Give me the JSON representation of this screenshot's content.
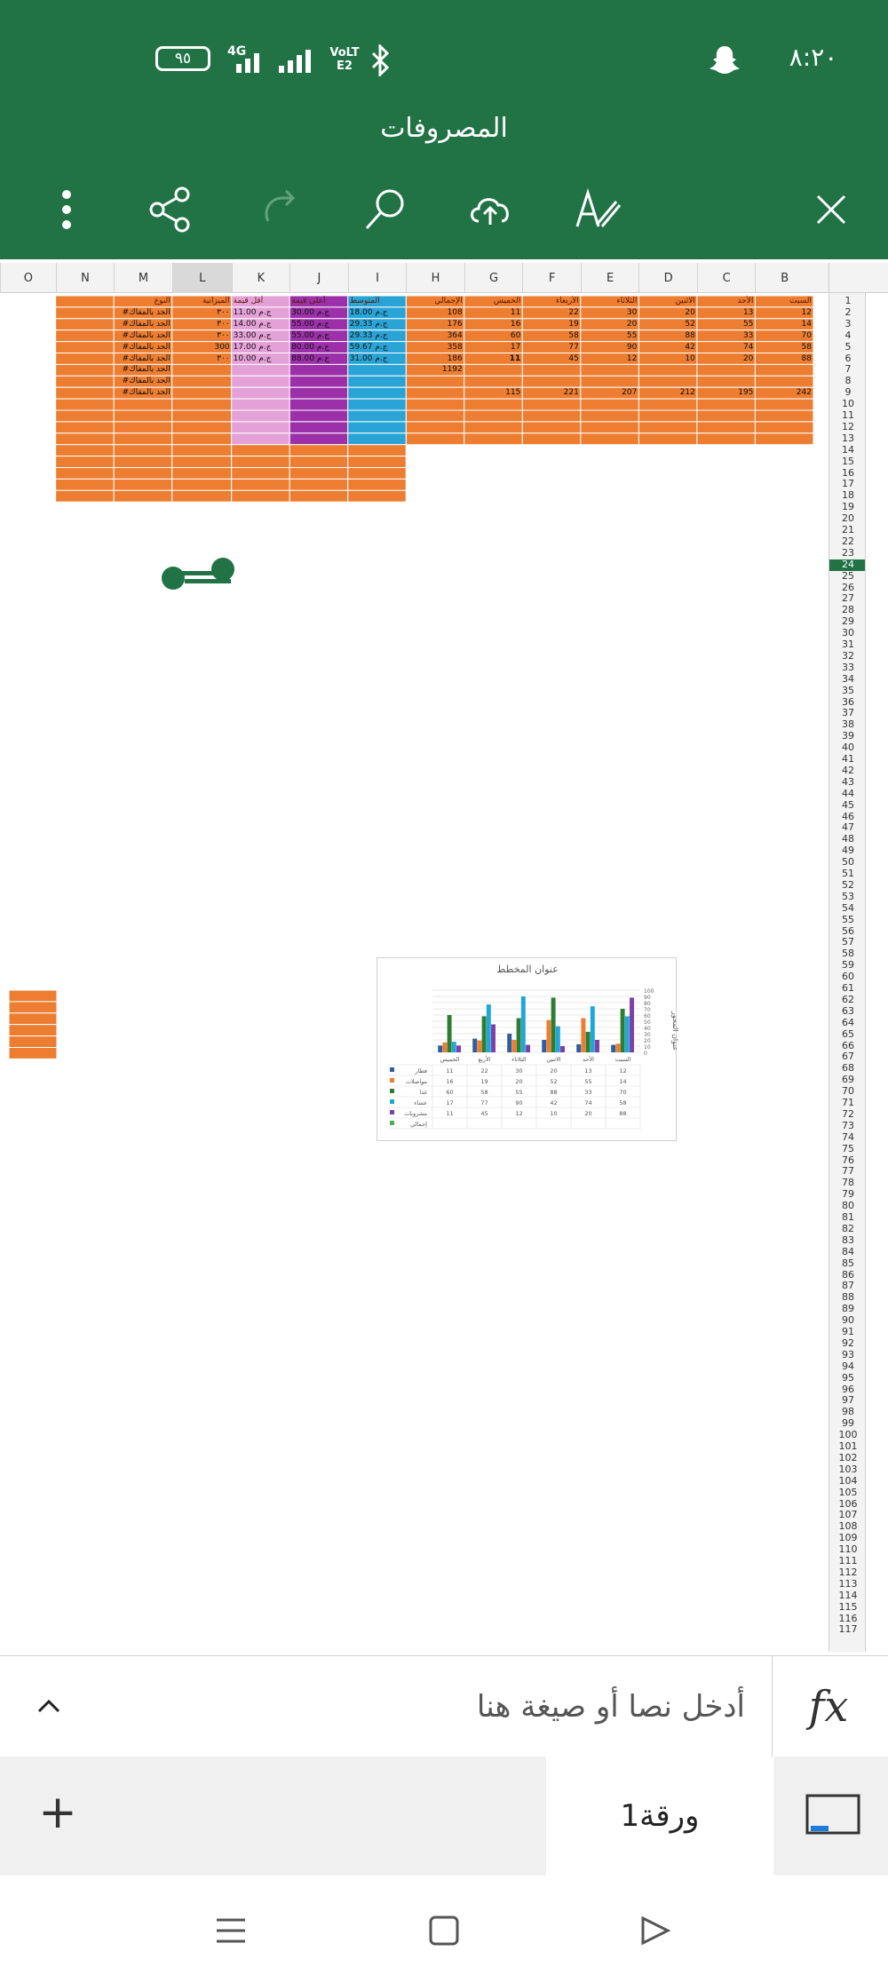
{
  "status": {
    "time": "٨:٢٠",
    "battery": "٩٥",
    "network_4g": "4G",
    "volte": "VoLTE2",
    "icons": [
      "battery-icon",
      "signal-icon",
      "signal-icon",
      "volte-icon",
      "bluetooth-icon",
      "snapchat-icon"
    ]
  },
  "header": {
    "title": "المصروفات"
  },
  "toolbar": {
    "icons": [
      "more-icon",
      "share-icon",
      "redo-icon",
      "search-icon",
      "cloud-upload-icon",
      "draw-icon",
      "close-icon"
    ]
  },
  "sheet": {
    "column_headers": [
      "O",
      "N",
      "M",
      "L",
      "K",
      "J",
      "I",
      "H",
      "G",
      "F",
      "E",
      "D",
      "C",
      "B"
    ],
    "header_row": [
      "النوع",
      "الميزانية",
      "أقل قيمة",
      "أعلى قيمة",
      "المتوسط",
      "الإجمالي",
      "الخميس",
      "الأربعاء",
      "الثلاثاء",
      "الاثنين",
      "الأحد",
      "السبت"
    ],
    "rows": [
      {
        "M": "#الحد بالمفاك",
        "L": "٣٠٠",
        "K": "ج.م 11.00",
        "J": "ج.م 30.00",
        "I": "ج.م 18.00",
        "H": "108",
        "G": "11",
        "F": "22",
        "E": "30",
        "D": "20",
        "C": "13",
        "B": "12"
      },
      {
        "M": "#الحد بالمفاك",
        "L": "٣٠٠",
        "K": "ج.م 14.00",
        "J": "ج.م 55.00",
        "I": "ج.م 29.33",
        "H": "176",
        "G": "16",
        "F": "19",
        "E": "20",
        "D": "52",
        "C": "55",
        "B": "14"
      },
      {
        "M": "#الحد بالمفاك",
        "L": "٣٠٠",
        "K": "ج.م 33.00",
        "J": "ج.م 55.00",
        "I": "ج.م 29.33",
        "H": "364",
        "G": "60",
        "F": "58",
        "E": "55",
        "D": "88",
        "C": "33",
        "B": "70"
      },
      {
        "M": "#الحد بالمفاك",
        "L": "300",
        "K": "ج.م 17.00",
        "J": "ج.م 80.00",
        "I": "ج.م 59.67",
        "H": "358",
        "G": "17",
        "F": "77",
        "E": "90",
        "D": "42",
        "C": "74",
        "B": "58"
      },
      {
        "M": "#الحد بالمفاك",
        "L": "٣٠٠",
        "K": "ج.م 10.00",
        "J": "ج.م 88.00",
        "I": "ج.م 31.00",
        "H": "186",
        "G": "11",
        "F": "45",
        "E": "12",
        "D": "10",
        "C": "20",
        "B": "88"
      },
      {
        "M": "#الحد بالمفاك",
        "H": "1192"
      },
      {
        "M": "#الحد بالمفاك"
      },
      {
        "M": "#الحد بالمفاك",
        "G": "115",
        "F": "221",
        "E": "207",
        "D": "212",
        "C": "195",
        "B": "242"
      }
    ],
    "row_numbers_start": 1,
    "row_numbers_end": 117,
    "selected_row": "24"
  },
  "chart_data": {
    "type": "bar",
    "title": "عنوان المخطط",
    "ylabel": "عنوان المحور",
    "categories": [
      "السبت",
      "الأحد",
      "الاثنين",
      "الثلاثاء",
      "الأربع",
      "الخميس"
    ],
    "series": [
      {
        "name": "فطار",
        "values": [
          12,
          13,
          20,
          30,
          22,
          11
        ],
        "color": "#2e5e9e"
      },
      {
        "name": "مواصلات",
        "values": [
          14,
          55,
          52,
          20,
          19,
          16
        ],
        "color": "#ed7d31"
      },
      {
        "name": "غدا",
        "values": [
          70,
          33,
          88,
          55,
          58,
          60
        ],
        "color": "#2e7d32"
      },
      {
        "name": "عشاء",
        "values": [
          58,
          74,
          42,
          90,
          77,
          17
        ],
        "color": "#1fa7d8"
      },
      {
        "name": "مشروبات",
        "values": [
          88,
          20,
          10,
          12,
          45,
          11
        ],
        "color": "#7e3fa8"
      },
      {
        "name": "إجمالي",
        "values": [],
        "color": "#4caf50"
      }
    ],
    "table_rows": [
      [
        "فطار",
        "11",
        "22",
        "30",
        "20",
        "13",
        "12"
      ],
      [
        "مواصلات",
        "16",
        "19",
        "20",
        "52",
        "55",
        "14"
      ],
      [
        "غدا",
        "60",
        "58",
        "55",
        "88",
        "33",
        "70"
      ],
      [
        "عشاء",
        "17",
        "77",
        "90",
        "42",
        "74",
        "58"
      ],
      [
        "مشروبات",
        "11",
        "45",
        "12",
        "10",
        "20",
        "88"
      ],
      [
        "إجمالي",
        "",
        "",
        "",
        "",
        "",
        ""
      ]
    ],
    "ylim": [
      0,
      100
    ],
    "yticks": [
      "100",
      "90",
      "80",
      "70",
      "60",
      "50",
      "40",
      "30",
      "20",
      "10",
      "0"
    ]
  },
  "formula": {
    "placeholder": "أدخل نصا أو صيغة هنا",
    "fx_label": "fx"
  },
  "tabs": {
    "sheet_name": "ورقة1",
    "add_label": "+"
  }
}
